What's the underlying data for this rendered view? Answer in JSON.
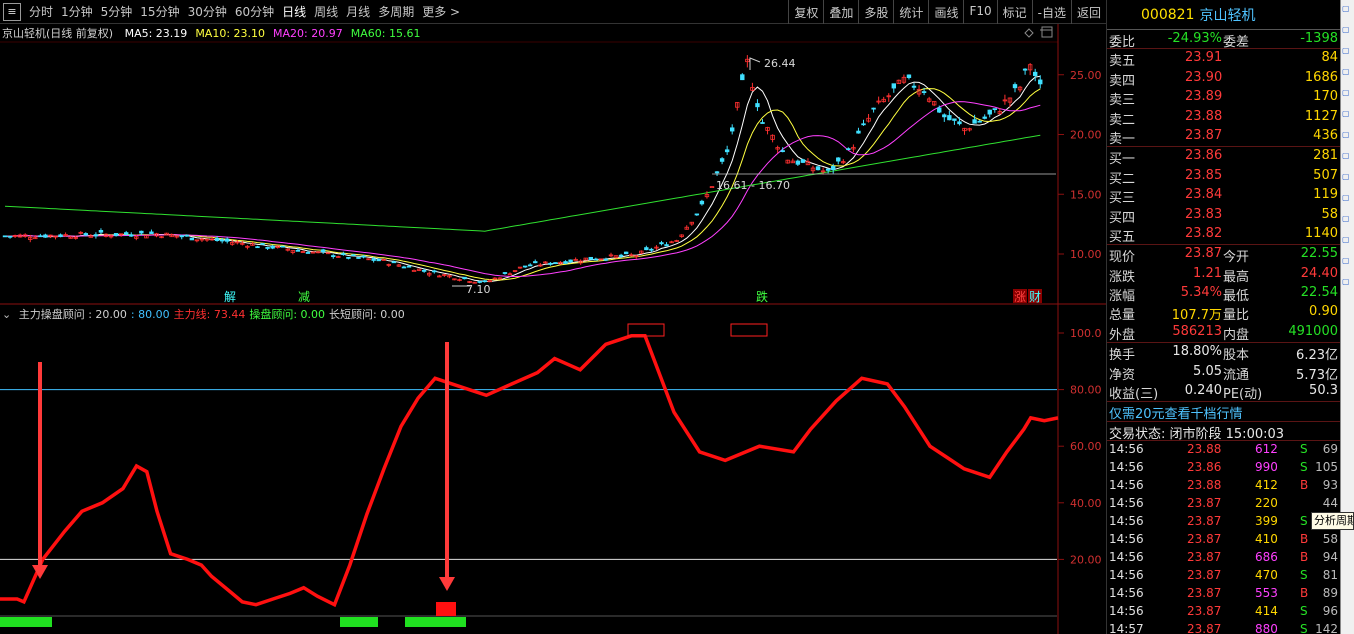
{
  "topbar": {
    "menu_icon": "menu-icon",
    "periods": [
      "分时",
      "1分钟",
      "5分钟",
      "15分钟",
      "30分钟",
      "60分钟",
      "日线",
      "周线",
      "月线",
      "多周期",
      "更多 >"
    ],
    "active_period": "日线",
    "tools": [
      "复权",
      "叠加",
      "多股",
      "统计",
      "画线",
      "F10",
      "标记",
      "-自选",
      "返回"
    ]
  },
  "main_chart": {
    "title": "京山轻机(日线 前复权)",
    "ma_labels": [
      {
        "text": "MA5: 23.19",
        "color": "#ffffff"
      },
      {
        "text": "MA10: 23.10",
        "color": "#ffff40"
      },
      {
        "text": "MA20: 20.97",
        "color": "#ff40ff"
      },
      {
        "text": "MA60: 15.61",
        "color": "#40ff40"
      }
    ],
    "y_ticks": [
      "25.00",
      "20.00",
      "15.00",
      "10.00"
    ],
    "high_mark": "26.44",
    "low_mark": "7.10",
    "range_mark": "16.61 - 16.70",
    "bottom_marks": [
      {
        "text": "解",
        "color": "#40ffff"
      },
      {
        "text": "减",
        "color": "#40ff40"
      },
      {
        "text": "跌",
        "color": "#40ff40"
      },
      {
        "text": "涨",
        "color": "#ff4040"
      },
      {
        "text": "财",
        "color": "#40ffff"
      }
    ]
  },
  "indicator": {
    "legend": [
      {
        "text": "主力操盘顾问 : 20.00",
        "color": "#d0d0d0"
      },
      {
        "text": ": 80.00",
        "color": "#40c0ff"
      },
      {
        "text": "主力线: 73.44",
        "color": "#ff3030"
      },
      {
        "text": "操盘顾问: 0.00",
        "color": "#40ff40"
      },
      {
        "text": "长短顾问: 0.00",
        "color": "#d0d0d0"
      }
    ],
    "y_ticks": [
      "100.0",
      "80.00",
      "60.00",
      "40.00",
      "20.00"
    ]
  },
  "stock": {
    "code": "000821",
    "name": "京山轻机"
  },
  "order_book": {
    "weibi": {
      "label": "委比",
      "value": "-24.93%",
      "label2": "委差",
      "value2": "-1398"
    },
    "asks": [
      {
        "label": "卖五",
        "price": "23.91",
        "vol": "84"
      },
      {
        "label": "卖四",
        "price": "23.90",
        "vol": "1686"
      },
      {
        "label": "卖三",
        "price": "23.89",
        "vol": "170"
      },
      {
        "label": "卖二",
        "price": "23.88",
        "vol": "1127"
      },
      {
        "label": "卖一",
        "price": "23.87",
        "vol": "436"
      }
    ],
    "bids": [
      {
        "label": "买一",
        "price": "23.86",
        "vol": "281"
      },
      {
        "label": "买二",
        "price": "23.85",
        "vol": "507"
      },
      {
        "label": "买三",
        "price": "23.84",
        "vol": "119"
      },
      {
        "label": "买四",
        "price": "23.83",
        "vol": "58"
      },
      {
        "label": "买五",
        "price": "23.82",
        "vol": "1140"
      }
    ]
  },
  "quote": [
    {
      "l1": "现价",
      "v1": "23.87",
      "c1": "red",
      "l2": "今开",
      "v2": "22.55",
      "c2": "green"
    },
    {
      "l1": "涨跌",
      "v1": "1.21",
      "c1": "red",
      "l2": "最高",
      "v2": "24.40",
      "c2": "red"
    },
    {
      "l1": "涨幅",
      "v1": "5.34%",
      "c1": "red",
      "l2": "最低",
      "v2": "22.54",
      "c2": "green"
    },
    {
      "l1": "总量",
      "v1": "107.7万",
      "c1": "yellow",
      "l2": "量比",
      "v2": "0.90",
      "c2": "yellow"
    },
    {
      "l1": "外盘",
      "v1": "586213",
      "c1": "red",
      "l2": "内盘",
      "v2": "491000",
      "c2": "green"
    }
  ],
  "stats": [
    {
      "l1": "换手",
      "v1": "18.80%",
      "l2": "股本",
      "v2": "6.23亿"
    },
    {
      "l1": "净资",
      "v1": "5.05",
      "l2": "流通",
      "v2": "5.73亿"
    },
    {
      "l1": "收益(三)",
      "v1": "0.240",
      "l2": "PE(动)",
      "v2": "50.3"
    }
  ],
  "promo": "仅需20元查看千档行情",
  "trade_status": "交易状态: 闭市阶段 15:00:03",
  "ticks": [
    {
      "t": "14:56",
      "p": "23.88",
      "v": "612",
      "vc": "#ff40ff",
      "d": "S",
      "dc": "#25e025",
      "n": "69"
    },
    {
      "t": "14:56",
      "p": "23.86",
      "v": "990",
      "vc": "#ff40ff",
      "d": "S",
      "dc": "#25e025",
      "n": "105"
    },
    {
      "t": "14:56",
      "p": "23.88",
      "v": "412",
      "vc": "#ffd700",
      "d": "B",
      "dc": "#ff3a3a",
      "n": "93"
    },
    {
      "t": "14:56",
      "p": "23.87",
      "v": "220",
      "vc": "#ffd700",
      "d": "",
      "dc": "#ffd700",
      "n": "44"
    },
    {
      "t": "14:56",
      "p": "23.87",
      "v": "399",
      "vc": "#ffd700",
      "d": "S",
      "dc": "#25e025",
      "n": "6"
    },
    {
      "t": "14:56",
      "p": "23.87",
      "v": "410",
      "vc": "#ffd700",
      "d": "B",
      "dc": "#ff3a3a",
      "n": "58"
    },
    {
      "t": "14:56",
      "p": "23.87",
      "v": "686",
      "vc": "#ff40ff",
      "d": "B",
      "dc": "#ff3a3a",
      "n": "94"
    },
    {
      "t": "14:56",
      "p": "23.87",
      "v": "470",
      "vc": "#ffd700",
      "d": "S",
      "dc": "#25e025",
      "n": "81"
    },
    {
      "t": "14:56",
      "p": "23.87",
      "v": "553",
      "vc": "#ff40ff",
      "d": "B",
      "dc": "#ff3a3a",
      "n": "89"
    },
    {
      "t": "14:56",
      "p": "23.87",
      "v": "414",
      "vc": "#ffd700",
      "d": "S",
      "dc": "#25e025",
      "n": "96"
    },
    {
      "t": "14:57",
      "p": "23.87",
      "v": "880",
      "vc": "#ff40ff",
      "d": "S",
      "dc": "#25e025",
      "n": "142"
    }
  ],
  "tooltip": "分析周期",
  "colors": {
    "up": "#ff3030",
    "down": "#40e0ff",
    "ma5": "#ffffff",
    "ma10": "#ffff40",
    "ma20": "#ff40ff",
    "ma60": "#30e030",
    "main_line": "#ff1010",
    "bg": "#000000"
  }
}
